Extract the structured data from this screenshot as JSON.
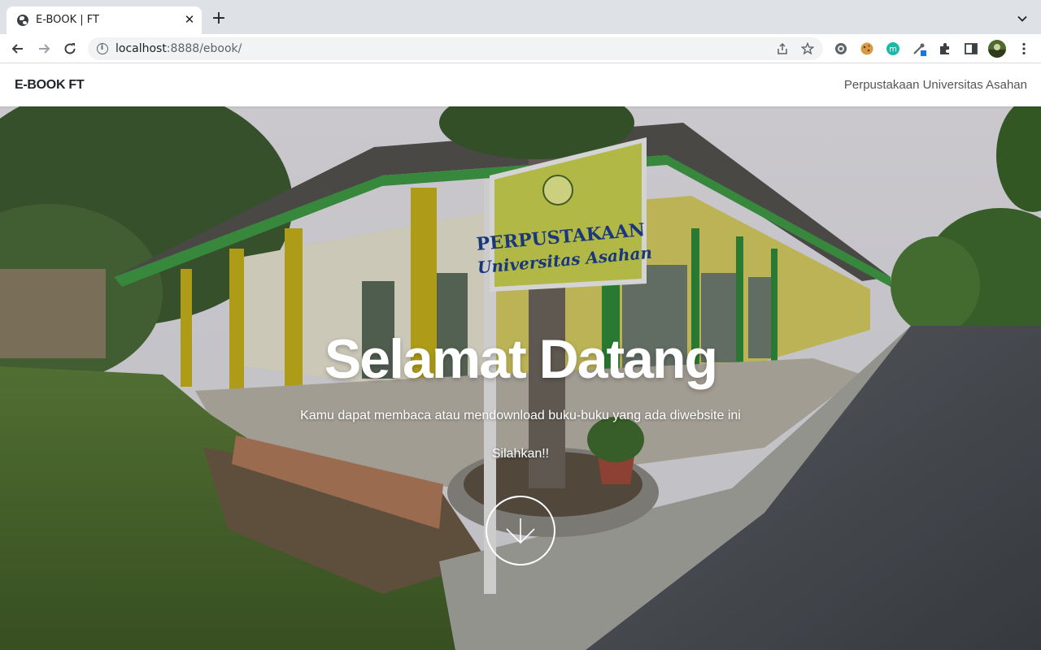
{
  "browser": {
    "tab_title": "E-BOOK | FT",
    "tab_close": "✕",
    "new_tab": "+",
    "url_host": "localhost",
    "url_rest": ":8888/ebook/"
  },
  "navbar": {
    "brand": "E-BOOK FT",
    "link": "Perpustakaan Universitas Asahan"
  },
  "hero": {
    "title": "Selamat Datang",
    "subtitle": "Kamu dapat membaca atau mendownload buku-buku yang ada diwebsite ini",
    "cta": "Silahkan!!",
    "sign_line1": "PERPUSTAKAAN",
    "sign_line2": "Universitas Asahan"
  },
  "icons": {
    "favicon": "globe-icon",
    "scroll": "arrow-down-icon"
  }
}
